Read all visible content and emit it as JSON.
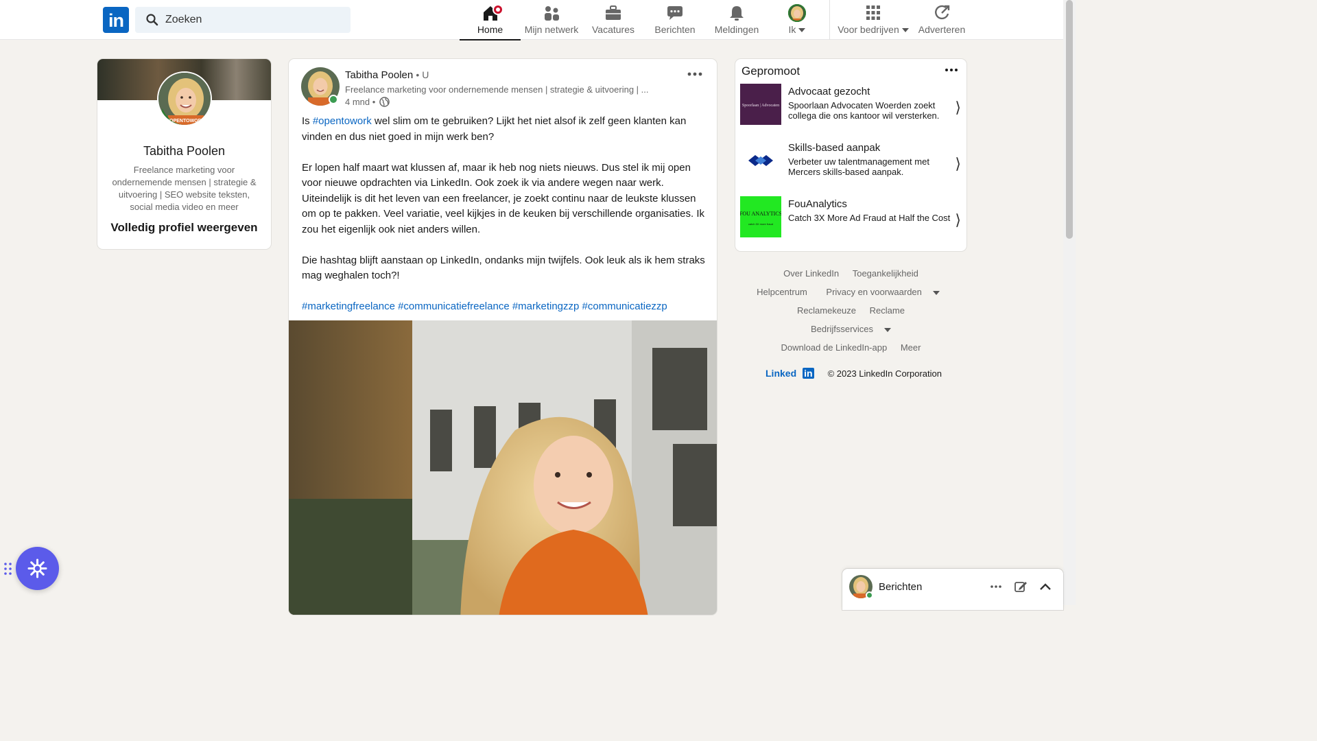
{
  "nav": {
    "logo_text": "in",
    "search_placeholder": "Zoeken",
    "items": [
      {
        "label": "Home",
        "icon": "home-icon",
        "active": true
      },
      {
        "label": "Mijn netwerk",
        "icon": "network-icon"
      },
      {
        "label": "Vacatures",
        "icon": "briefcase-icon"
      },
      {
        "label": "Berichten",
        "icon": "messaging-icon"
      },
      {
        "label": "Meldingen",
        "icon": "bell-icon"
      },
      {
        "label": "Ik",
        "icon": "avatar"
      },
      {
        "label": "Voor bedrijven",
        "icon": "grid-icon"
      },
      {
        "label": "Adverteren",
        "icon": "advertise-icon"
      }
    ]
  },
  "profile": {
    "name": "Tabitha Poolen",
    "headline": "Freelance marketing voor ondernemende mensen | strategie & uitvoering | SEO website teksten, social media video en meer",
    "view_link": "Volledig profiel weergeven",
    "frame_text": "#OPENTOWORK"
  },
  "post": {
    "author": "Tabitha Poolen",
    "degree": "• U",
    "subtitle": "Freelance marketing voor ondernemende mensen | strategie & uitvoering | ...",
    "time": "4 mnd •",
    "p1_before": "Is ",
    "p1_tag": "#opentowork",
    "p1_after": " wel slim om te gebruiken? Lijkt het niet alsof ik zelf geen klanten kan vinden en dus niet goed in mijn werk ben?",
    "p2": "Er lopen half maart wat klussen af, maar ik heb nog niets nieuws. Dus stel ik mij open voor nieuwe opdrachten via LinkedIn. Ook zoek ik via andere wegen naar werk. Uiteindelijk is dit het leven van een freelancer, je zoekt continu naar de leukste klussen om op te pakken. Veel variatie, veel kijkjes in de keuken bij verschillende organisaties. Ik zou het eigenlijk ook niet anders willen.",
    "p3": "Die hashtag blijft aanstaan op LinkedIn, ondanks mijn twijfels. Ook leuk als ik hem straks mag weghalen toch?!",
    "hashtags": "#marketingfreelance #communicatiefreelance #marketingzzp #communicatiezzp"
  },
  "promoted": {
    "heading": "Gepromoot",
    "ads": [
      {
        "title": "Advocaat gezocht",
        "desc": "Spoorlaan Advocaten Woerden zoekt collega die ons kantoor wil versterken.",
        "logo_text": "Spoorlaan | Advocaten"
      },
      {
        "title": "Skills-based aanpak",
        "desc": "Verbeter uw talentmanagement met Mercers skills-based aanpak."
      },
      {
        "title": "FouAnalytics",
        "desc": "Catch 3X More Ad Fraud at Half the Cost",
        "logo_text": "FOU ANALYTICS",
        "logo_sub": "catch 3X more fraud"
      }
    ]
  },
  "footer": {
    "links": [
      "Over LinkedIn",
      "Toegankelijkheid",
      "Helpcentrum",
      "Privacy en voorwaarden",
      "Reclamekeuze",
      "Reclame",
      "Bedrijfsservices",
      "Download de LinkedIn-app",
      "Meer"
    ],
    "brand_a": "Linked",
    "brand_b": "in",
    "copyright": "© 2023 LinkedIn Corporation"
  },
  "messaging": {
    "title": "Berichten"
  },
  "colors": {
    "brand": "#0a66c2",
    "notification": "#cb112d",
    "fab": "#5b5bea",
    "online": "#3b9c52"
  }
}
